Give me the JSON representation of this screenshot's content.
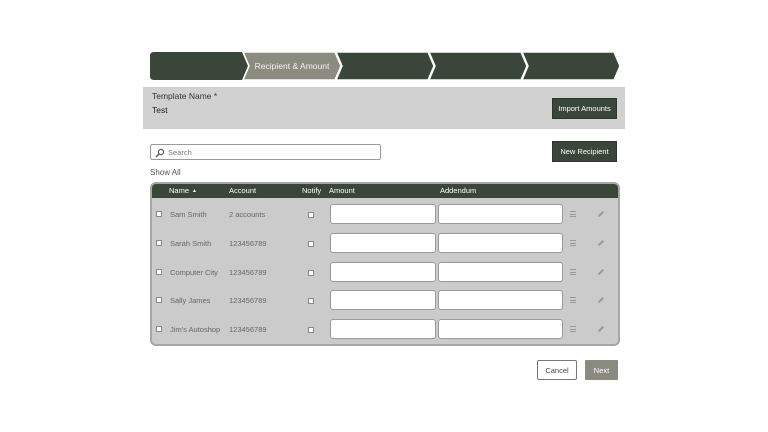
{
  "stepper": {
    "steps": [
      {
        "label": "",
        "active": false
      },
      {
        "label": "Recipient & Amount",
        "active": true
      },
      {
        "label": "",
        "active": false
      },
      {
        "label": "",
        "active": false
      },
      {
        "label": "",
        "active": false
      }
    ]
  },
  "template": {
    "label": "Template Name *",
    "value": "Test",
    "import_label": "Import Amounts"
  },
  "search": {
    "placeholder": "Search",
    "icon": "search-icon"
  },
  "new_recipient_label": "New Recipient",
  "show_all_label": "Show All",
  "table": {
    "headers": {
      "name": "Name",
      "account": "Account",
      "notify": "Notify",
      "amount": "Amount",
      "addendum": "Addendum"
    },
    "sort_icon": "▲",
    "rows": [
      {
        "name": "Sam Smith",
        "account": "2 accounts"
      },
      {
        "name": "Sarah Smith",
        "account": "123456789"
      },
      {
        "name": "Computer City",
        "account": "123456789"
      },
      {
        "name": "Sally James",
        "account": "123456789"
      },
      {
        "name": "Jim's Autoshop",
        "account": "123456789"
      }
    ]
  },
  "footer": {
    "cancel_label": "Cancel",
    "next_label": "Next"
  },
  "colors": {
    "dark_green": "#3a4639",
    "active_step": "#8b8b80",
    "panel": "#d1d1d1",
    "next": "#8a8a80"
  }
}
